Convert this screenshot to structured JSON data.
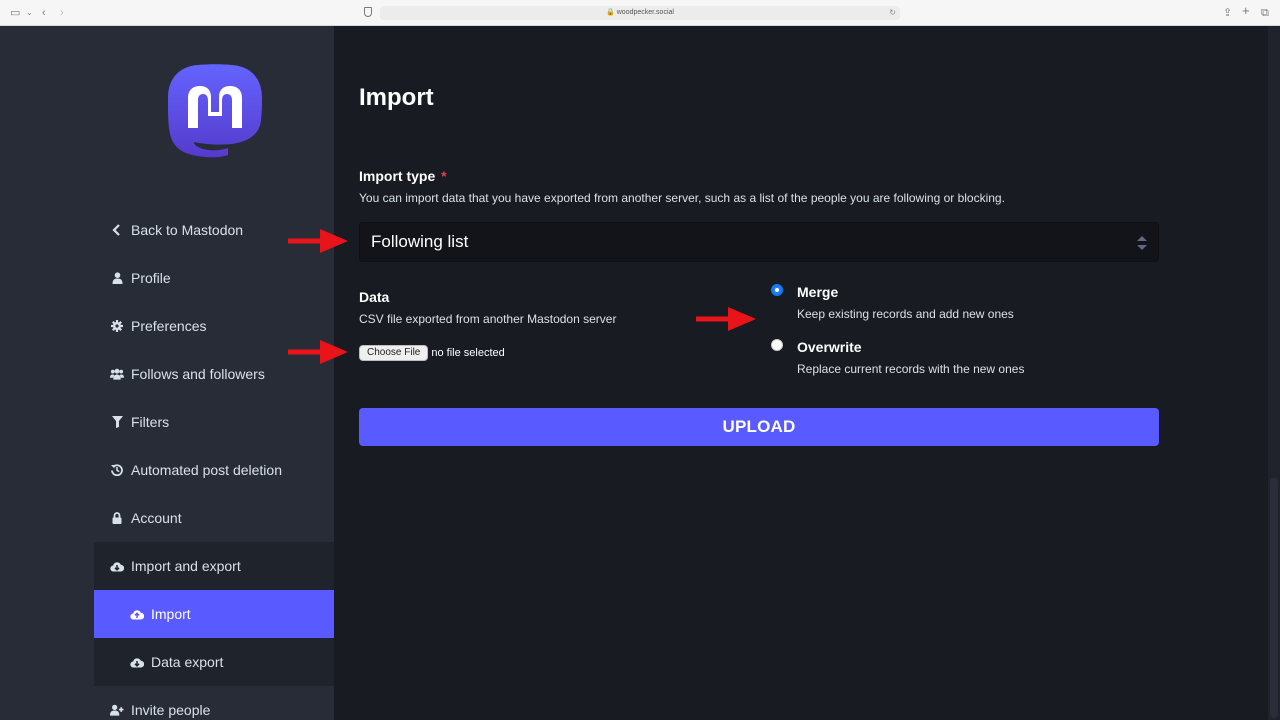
{
  "browser": {
    "url": "woodpecker.social"
  },
  "sidebar": {
    "items": [
      {
        "label": "Back to Mastodon",
        "icon": "chevron-left-icon"
      },
      {
        "label": "Profile",
        "icon": "user-icon"
      },
      {
        "label": "Preferences",
        "icon": "gear-icon"
      },
      {
        "label": "Follows and followers",
        "icon": "users-icon"
      },
      {
        "label": "Filters",
        "icon": "filter-icon"
      },
      {
        "label": "Automated post deletion",
        "icon": "history-icon"
      },
      {
        "label": "Account",
        "icon": "lock-icon"
      },
      {
        "label": "Import and export",
        "icon": "cloud-download-icon"
      },
      {
        "label": "Import",
        "icon": "cloud-upload-icon"
      },
      {
        "label": "Data export",
        "icon": "cloud-download-icon"
      },
      {
        "label": "Invite people",
        "icon": "user-plus-icon"
      }
    ],
    "active_item": "Import"
  },
  "main": {
    "title": "Import",
    "import_type": {
      "label": "Import type",
      "required_mark": "*",
      "hint": "You can import data that you have exported from another server, such as a list of the people you are following or blocking.",
      "selected": "Following list"
    },
    "data": {
      "label": "Data",
      "hint": "CSV file exported from another Mastodon server",
      "choose_file_label": "Choose File",
      "file_status": "no file selected"
    },
    "mode": {
      "selected": "merge",
      "options": [
        {
          "label": "Merge",
          "hint": "Keep existing records and add new ones"
        },
        {
          "label": "Overwrite",
          "hint": "Replace current records with the new ones"
        }
      ]
    },
    "upload_label": "UPLOAD"
  },
  "colors": {
    "accent": "#595aff",
    "sidebar_bg": "#282c37",
    "main_bg": "#191b22",
    "annotation_arrow": "#e8141a"
  }
}
